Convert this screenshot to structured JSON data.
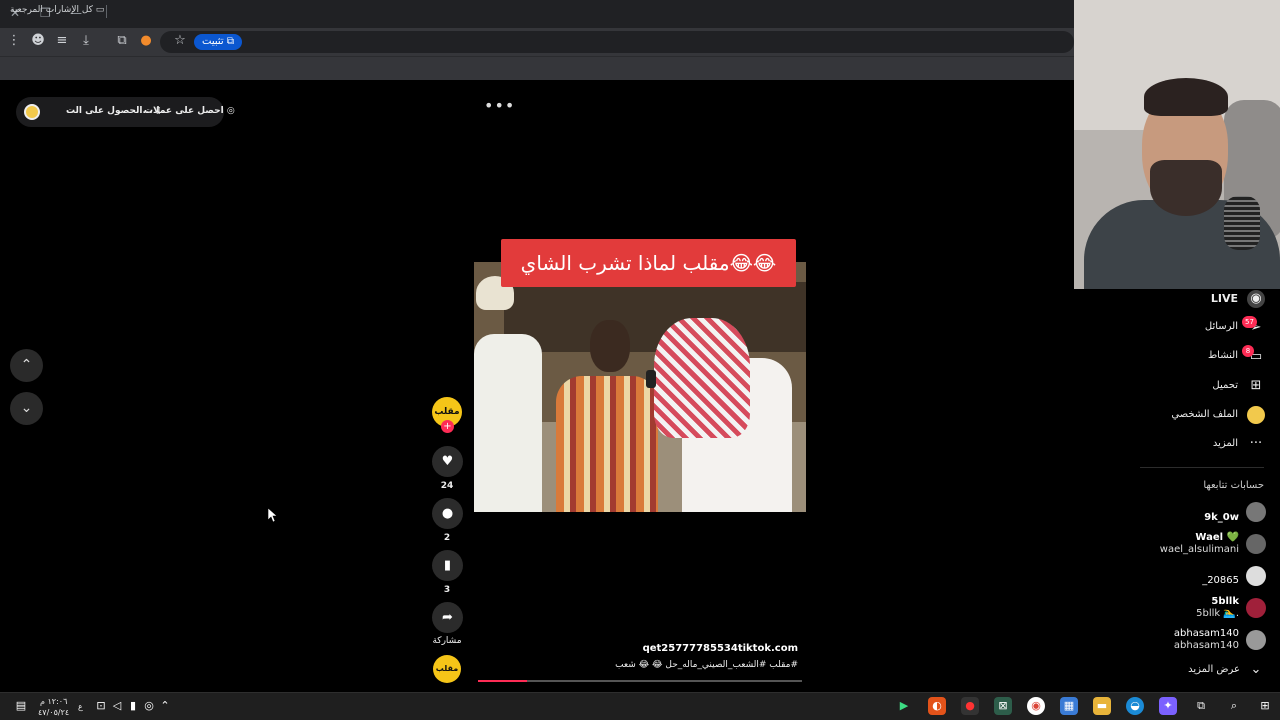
{
  "browser": {
    "install_label": "تثبيت",
    "bookmarks_label": "كل الإشارات المرجعية"
  },
  "promo": {
    "get_coins": "احصل على عملات",
    "get_app": "الحصول على الت..."
  },
  "video": {
    "caption_overlay": "مقلب لماذا تشرب الشاي😂😂",
    "author": "qet25777785534tiktok.com",
    "description": "#مقلب #الشعب_الصيني_ماله_حل 😂 😂 شعب",
    "progress": 0.15
  },
  "actions": {
    "avatar_label": "مقلب",
    "likes": "24",
    "comments": "2",
    "saves": "3",
    "share_label": "مشاركة",
    "music_label": "مقلب"
  },
  "sidebar": {
    "live": "LIVE",
    "messages": "الرسائل",
    "messages_badge": "57",
    "activity": "النشاط",
    "activity_badge": "8",
    "upload": "تحميل",
    "profile": "الملف الشخصي",
    "more": "المزيد",
    "following_heading": "حسابات تتابعها",
    "see_more": "عرض المزيد",
    "accounts": [
      {
        "name": "9k_0w",
        "sub": ""
      },
      {
        "name": "Wael 💚",
        "sub": "wael_alsulimani"
      },
      {
        "name": "_20865",
        "sub": ""
      },
      {
        "name": "5bllk",
        "sub": "5bllk 🏊‍♂️."
      },
      {
        "name": "abhasam140",
        "sub": "abhasam140"
      }
    ]
  },
  "taskbar": {
    "time": "١٢:٠٦ م",
    "date": "٤٧/٠٥/٢٤",
    "lang": "ع"
  },
  "colors": {
    "accent": "#fe2c55",
    "caption_bg": "#e23b3b",
    "install_chip": "#0b57d0"
  }
}
